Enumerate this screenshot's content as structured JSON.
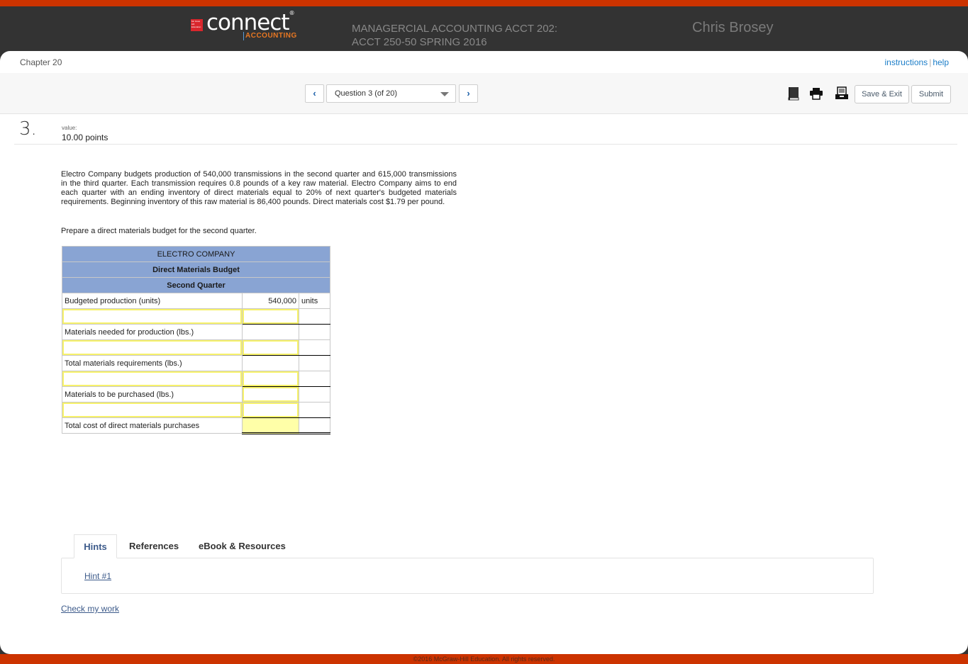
{
  "header": {
    "logo": {
      "mark_text": "Mc Graw Hill Education",
      "wordmark": "connect",
      "registered": "®",
      "product": "ACCOUNTING"
    },
    "course_line1": "MANAGERCIAL ACCOUNTING ACCT 202:",
    "course_line2": "ACCT 250-50 SPRING 2016",
    "user_name": "Chris Brosey"
  },
  "subheader": {
    "chapter": "Chapter 20",
    "instructions_link": "instructions",
    "separator": "|",
    "help_link": "help"
  },
  "toolbar": {
    "prev_icon": "chevron-left-icon",
    "prev_glyph": "‹",
    "next_icon": "chevron-right-icon",
    "next_glyph": "›",
    "question_select": "Question 3 (of 20)",
    "icons": [
      "book-icon",
      "print-icon",
      "archive-icon"
    ],
    "save_exit_label": "Save & Exit",
    "submit_label": "Submit"
  },
  "question": {
    "number": "3.",
    "value_label": "value:",
    "value": "10.00 points",
    "text": "Electro Company budgets production of 540,000 transmissions in the second quarter and 615,000 transmissions in the third quarter. Each transmission requires 0.8 pounds of a key raw material. Electro Company aims to end each quarter with an ending inventory of direct materials equal to 20% of next quarter's budgeted materials requirements. Beginning inventory of this raw material is 86,400 pounds. Direct materials cost $1.79 per pound.",
    "instruction": "Prepare a direct materials budget for the second quarter."
  },
  "budget": {
    "company": "ELECTRO COMPANY",
    "title": "Direct Materials Budget",
    "period": "Second Quarter",
    "rows": [
      {
        "label": "Budgeted production (units)",
        "value": "540,000",
        "unit": "units",
        "type": "static"
      },
      {
        "label": "",
        "value": "",
        "unit": "",
        "type": "input"
      },
      {
        "label": "Materials needed for production (lbs.)",
        "value": "",
        "unit": "",
        "type": "static"
      },
      {
        "label": "",
        "value": "",
        "unit": "",
        "type": "input"
      },
      {
        "label": "Total materials requirements (lbs.)",
        "value": "",
        "unit": "",
        "type": "static"
      },
      {
        "label": "",
        "value": "",
        "unit": "",
        "type": "input"
      },
      {
        "label": "Materials to be purchased (lbs.)",
        "value": "",
        "unit": "",
        "type": "static-input"
      },
      {
        "label": "",
        "value": "",
        "unit": "",
        "type": "input"
      },
      {
        "label": "Total cost of direct materials purchases",
        "value": "",
        "unit": "",
        "type": "total"
      }
    ]
  },
  "resources": {
    "tabs": [
      "Hints",
      "References",
      "eBook & Resources"
    ],
    "active_tab": "Hints",
    "hint_link": "Hint #1",
    "check_work": "Check my work"
  },
  "footer": {
    "copyright": "©2016 McGraw-Hill Education. All rights reserved."
  },
  "colors": {
    "brand_orange": "#cc3300",
    "header_bg": "#333333",
    "table_header": "#89a4d3",
    "input_border": "#f7f26a",
    "total_highlight": "#ffffa8",
    "link_blue": "#1b7dc8"
  }
}
